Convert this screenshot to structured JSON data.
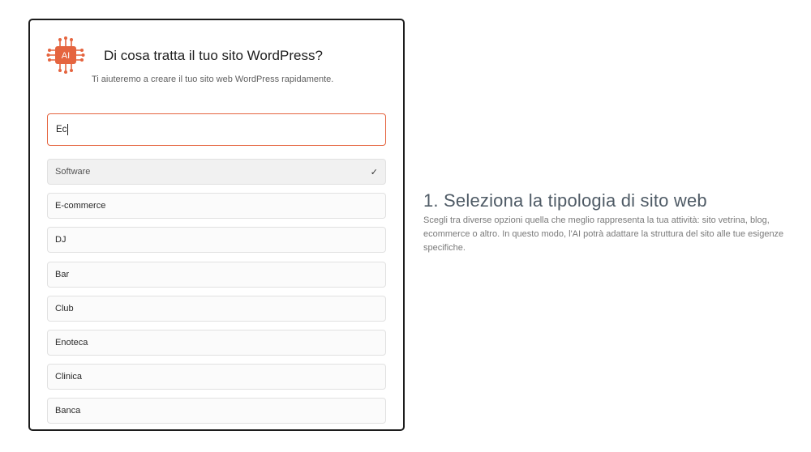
{
  "card": {
    "logo_text": "AI",
    "title": "Di cosa tratta il tuo sito WordPress?",
    "subtitle": "Ti aiuteremo a creare il tuo sito web WordPress rapidamente.",
    "search_value": "Ec",
    "options": [
      {
        "label": "Software",
        "selected": true
      },
      {
        "label": "E-commerce",
        "selected": false
      },
      {
        "label": "DJ",
        "selected": false
      },
      {
        "label": "Bar",
        "selected": false
      },
      {
        "label": "Club",
        "selected": false
      },
      {
        "label": "Enoteca",
        "selected": false
      },
      {
        "label": "Clinica",
        "selected": false
      },
      {
        "label": "Banca",
        "selected": false
      }
    ],
    "check_icon": "check-icon"
  },
  "info": {
    "title": "1. Seleziona la tipologia di sito web",
    "text": "Scegli tra diverse opzioni quella che meglio rappresenta la tua attività: sito vetrina, blog, ecommerce o altro. In questo modo, l'AI potrà adattare la struttura del sito alle tue esigenze specifiche."
  },
  "colors": {
    "accent": "#e5643f",
    "border": "#1c1c1c"
  }
}
